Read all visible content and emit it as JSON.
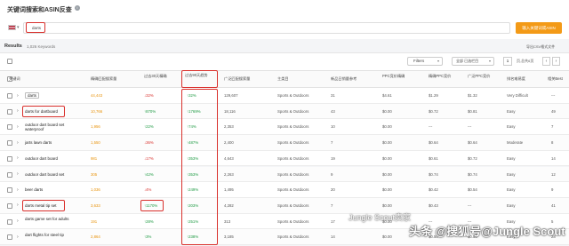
{
  "header": {
    "title": "关键词搜索和ASIN反查",
    "info_icon": "info-icon"
  },
  "search": {
    "flag_icon": "us-flag-icon",
    "value": "darts",
    "button_label": "输入关键词或ASIN"
  },
  "results": {
    "label": "Results",
    "count": "1,026 Keywords",
    "export_label": "导出CSV格式文件"
  },
  "toolbar": {
    "filters_label": "Filters",
    "columns_label": "全部 已选栏目",
    "page_value": "1",
    "page_total": "页,总共6页",
    "prev_icon": "chevron-left-icon",
    "next_icon": "chevron-right-icon"
  },
  "columns": [
    "关键词",
    "精确匹配搜索量",
    "过去30天精确",
    "过去90天趋势",
    "广泛匹配搜索量",
    "主类目",
    "新品日销量参考",
    "PPC竞价精确",
    "精确PPC竞价",
    "广泛PPC竞价",
    "排名难易度",
    "相关Best"
  ],
  "rows": [
    {
      "keyword": "darts",
      "exact": "44,443",
      "d30": "32%",
      "d30_dir": "down",
      "d90": "32%",
      "d90_dir": "up",
      "broad": "129,607",
      "category": "Sports & Outdoors",
      "daily": "31",
      "ppc1": "$4.61",
      "ppc2": "$1.29",
      "ppc3": "$1.32",
      "difficulty": "Very Difficult",
      "last": "---"
    },
    {
      "keyword": "darts for dartboard",
      "exact": "10,766",
      "d30": "870%",
      "d30_dir": "up",
      "d90": "1769%",
      "d90_dir": "up",
      "broad": "18,116",
      "category": "Sports & Outdoors",
      "daily": "43",
      "ppc1": "$0.00",
      "ppc2": "$0.72",
      "ppc3": "$0.81",
      "difficulty": "Easy",
      "last": "49"
    },
    {
      "keyword": "outdoor dart board set waterproof",
      "exact": "1,956",
      "d30": "22%",
      "d30_dir": "up",
      "d90": "74%",
      "d90_dir": "up",
      "broad": "2,353",
      "category": "Sports & Outdoors",
      "daily": "10",
      "ppc1": "$0.00",
      "ppc2": "---",
      "ppc3": "---",
      "difficulty": "Easy",
      "last": "7"
    },
    {
      "keyword": "jarts lawn darts",
      "exact": "1,550",
      "d30": "36%",
      "d30_dir": "down",
      "d90": "487%",
      "d90_dir": "up",
      "broad": "2,400",
      "category": "Sports & Outdoors",
      "daily": "7",
      "ppc1": "$0.00",
      "ppc2": "$0.64",
      "ppc3": "$0.64",
      "difficulty": "Moderate",
      "last": "8"
    },
    {
      "keyword": "outdoor dart board",
      "exact": "981",
      "d30": "17%",
      "d30_dir": "down",
      "d90": "353%",
      "d90_dir": "up",
      "broad": "4,643",
      "category": "Sports & Outdoors",
      "daily": "19",
      "ppc1": "$0.00",
      "ppc2": "$0.61",
      "ppc3": "$0.72",
      "difficulty": "Easy",
      "last": "14"
    },
    {
      "keyword": "outdoor dart board set",
      "exact": "305",
      "d30": "42%",
      "d30_dir": "up",
      "d90": "353%",
      "d90_dir": "up",
      "broad": "2,263",
      "category": "Sports & Outdoors",
      "daily": "9",
      "ppc1": "$0.00",
      "ppc2": "$0.74",
      "ppc3": "$0.74",
      "difficulty": "Easy",
      "last": "12"
    },
    {
      "keyword": "beer darts",
      "exact": "1,036",
      "d30": "4%",
      "d30_dir": "down",
      "d90": "249%",
      "d90_dir": "up",
      "broad": "1,495",
      "category": "Sports & Outdoors",
      "daily": "20",
      "ppc1": "$0.00",
      "ppc2": "$0.42",
      "ppc3": "$0.54",
      "difficulty": "Easy",
      "last": "9"
    },
    {
      "keyword": "darts metal tip set",
      "exact": "3,633",
      "d30": "1170%",
      "d30_dir": "up",
      "d90": "203%",
      "d90_dir": "up",
      "broad": "4,282",
      "category": "Sports & Outdoors",
      "daily": "7",
      "ppc1": "$0.00",
      "ppc2": "$0.43",
      "ppc3": "---",
      "difficulty": "Easy",
      "last": "41"
    },
    {
      "keyword": "darts game set for adults",
      "exact": "191",
      "d30": "28%",
      "d30_dir": "up",
      "d90": "251%",
      "d90_dir": "up",
      "broad": "313",
      "category": "Sports & Outdoors",
      "daily": "17",
      "ppc1": "$0.00",
      "ppc2": "---",
      "ppc3": "---",
      "difficulty": "Easy",
      "last": "5"
    },
    {
      "keyword": "dart flights for steel tip",
      "exact": "2,864",
      "d30": "3%",
      "d30_dir": "up",
      "d90": "238%",
      "d90_dir": "up",
      "broad": "3,185",
      "category": "Sports & Outdoors",
      "daily": "14",
      "ppc1": "$0.00",
      "ppc2": "$0.50",
      "ppc3": "$0.56",
      "difficulty": "Easy",
      "last": "28"
    }
  ],
  "watermark": {
    "line1": "Jungle Scout卖家",
    "line2": "头条 @搜狐号@Jungle Scout"
  },
  "colors": {
    "accent_orange": "#f39a17",
    "highlight_red": "#d9302c",
    "up_green": "#1d9a42",
    "down_red": "#d9302c",
    "number_orange": "#e8930c"
  }
}
